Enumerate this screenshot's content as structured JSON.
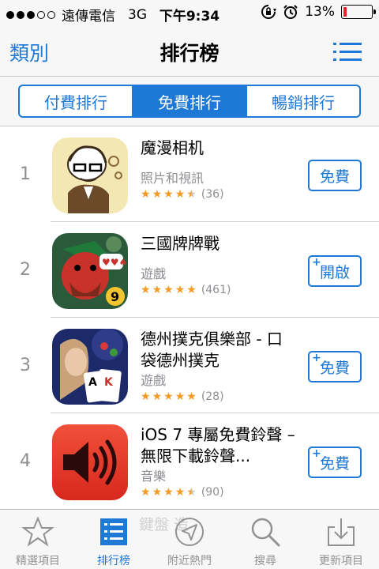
{
  "status_bar": {
    "carrier": "遠傳電信",
    "network": "3G",
    "time": "下午9:34",
    "battery": "13%",
    "battery_level": 0.13,
    "battery_color": "#e0242c"
  },
  "nav": {
    "left_label": "類別",
    "title": "排行榜",
    "right_icon": "list-icon"
  },
  "segments": [
    {
      "label": "付費排行",
      "active": false
    },
    {
      "label": "免費排行",
      "active": true
    },
    {
      "label": "暢銷排行",
      "active": false
    }
  ],
  "apps": [
    {
      "rank": "1",
      "name": "魔漫相机",
      "category": "照片和視訊",
      "rating": 4.5,
      "count": "(36)",
      "button": "免費",
      "plus": false,
      "icon": "cartoon-portrait-app-icon"
    },
    {
      "rank": "2",
      "name": "三國牌牌戰",
      "category": "遊戲",
      "rating": 5,
      "count": "(461)",
      "button": "開啟",
      "plus": true,
      "icon": "three-kingdoms-card-app-icon"
    },
    {
      "rank": "3",
      "name": "德州撲克俱樂部 - 口袋德州撲克",
      "category": "遊戲",
      "rating": 5,
      "count": "(28)",
      "button": "免費",
      "plus": true,
      "icon": "texas-poker-app-icon"
    },
    {
      "rank": "4",
      "name": "iOS 7 專屬免費鈴聲 – 無限下載鈴聲...",
      "category": "音樂",
      "rating": 4.5,
      "count": "(90)",
      "button": "免費",
      "plus": true,
      "icon": "speaker-ringtone-app-icon"
    }
  ],
  "tabs": [
    {
      "label": "精選項目",
      "icon": "star-icon",
      "active": false
    },
    {
      "label": "排行榜",
      "icon": "ranking-list-icon",
      "active": true
    },
    {
      "label": "附近熱門",
      "icon": "location-arrow-icon",
      "active": false
    },
    {
      "label": "搜尋",
      "icon": "search-icon",
      "active": false
    },
    {
      "label": "更新項目",
      "icon": "download-tray-icon",
      "active": false
    }
  ],
  "ghost_text": "鍵盤 造",
  "accent_color": "#1e78d6",
  "star_color": "#f59b23"
}
